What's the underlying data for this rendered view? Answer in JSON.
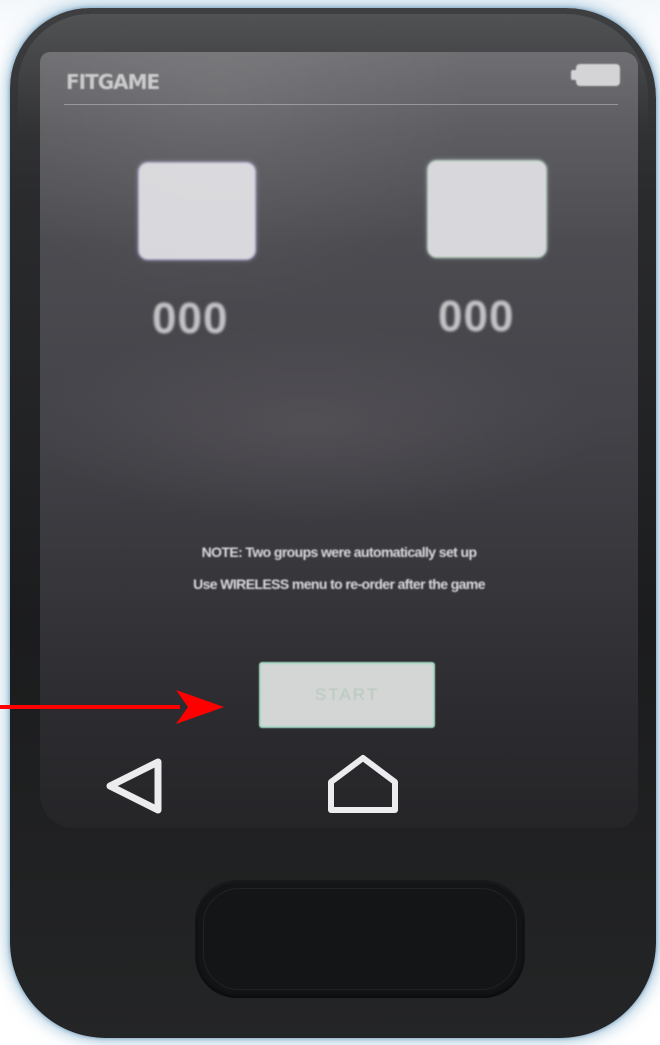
{
  "app": {
    "title": "FITGAME"
  },
  "status_bar": {
    "battery_icon": "battery-icon"
  },
  "groups": [
    {
      "name": "group-a",
      "score": "000",
      "icon": "group-a-square-icon"
    },
    {
      "name": "group-b",
      "score": "000",
      "icon": "group-b-square-icon"
    }
  ],
  "note": {
    "line1": "NOTE: Two groups were automatically set up",
    "line2": "Use WIRELESS menu to re-order after the game"
  },
  "start_button": {
    "label": "START"
  },
  "nav": {
    "back_icon": "back-triangle-icon",
    "home_icon": "home-icon"
  },
  "annotation": {
    "arrow_icon": "red-arrow-icon",
    "arrow_color": "#ff0000"
  },
  "colors": {
    "screen_top": "#6f6f73",
    "screen_bottom": "#252528",
    "device_body": "#1b1c1d",
    "start_button_border": "#a7d8c4"
  }
}
